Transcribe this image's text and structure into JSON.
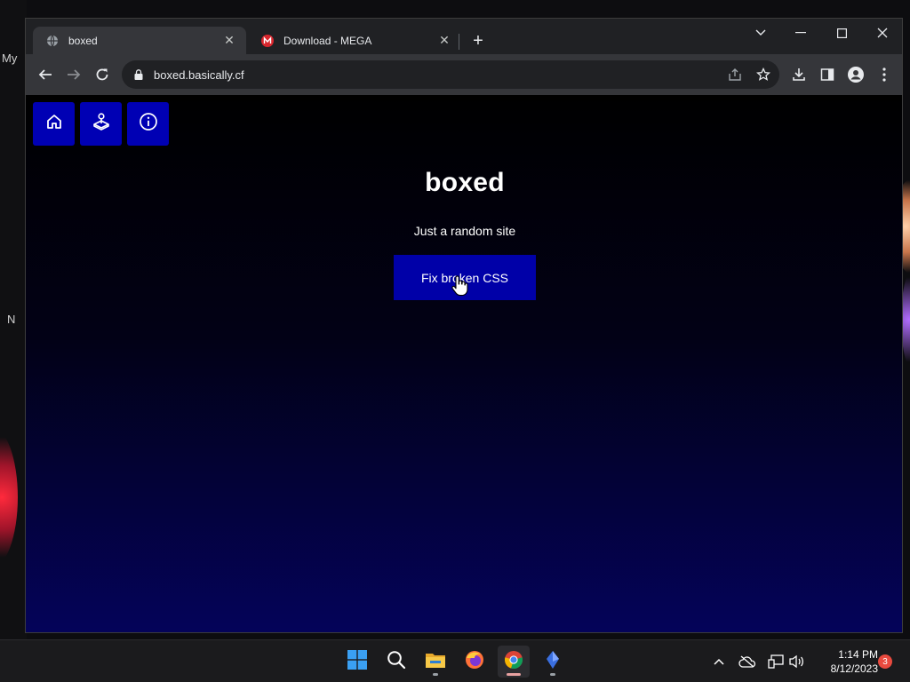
{
  "desktop": {
    "frag_1": "My",
    "frag_2": "N"
  },
  "browser": {
    "tabs": [
      {
        "title": "boxed",
        "favicon": "globe-icon",
        "active": true
      },
      {
        "title": "Download - MEGA",
        "favicon": "mega-icon",
        "active": false
      }
    ],
    "url": "boxed.basically.cf"
  },
  "page": {
    "nav": [
      {
        "icon": "home-icon",
        "label": "Home"
      },
      {
        "icon": "joystick-icon",
        "label": "Games"
      },
      {
        "icon": "info-icon",
        "label": "About"
      }
    ],
    "title": "boxed",
    "subtitle": "Just a random site",
    "button_label": "Fix broken CSS"
  },
  "colors": {
    "page_bg_top": "#000000",
    "page_bg_bottom": "#04035a",
    "accent_blue": "#0000b4",
    "button_blue": "#0000a8"
  },
  "taskbar": {
    "apps": [
      "windows-start-icon",
      "search-icon",
      "file-explorer-icon",
      "firefox-icon",
      "chrome-icon",
      "crystal-app-icon"
    ],
    "time": "1:14 PM",
    "date": "8/12/2023",
    "notification_count": "3"
  }
}
